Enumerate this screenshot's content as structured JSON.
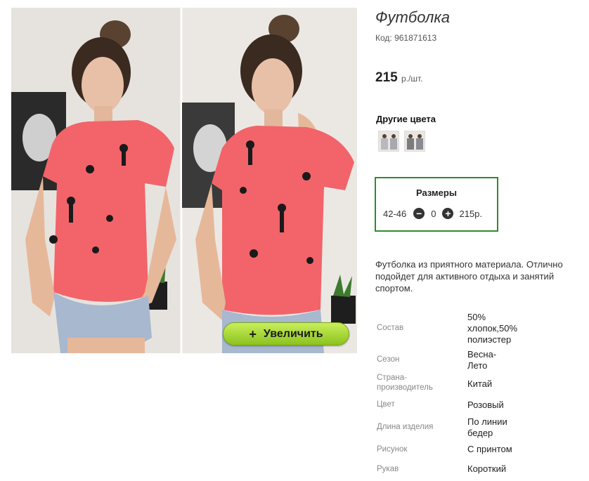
{
  "product": {
    "title": "Футболка",
    "sku": "Код: 961871613",
    "price": "215",
    "price_unit": "р./шт.",
    "zoom_label": "Увеличить",
    "zoom_plus": "+"
  },
  "other_colors": {
    "label": "Другие цвета",
    "swatches": [
      "color-swatch-1",
      "color-swatch-2"
    ]
  },
  "sizes": {
    "title": "Размеры",
    "rows": [
      {
        "size": "42-46",
        "minus": "−",
        "qty": "0",
        "plus": "+",
        "price": "215р."
      }
    ]
  },
  "description": "Футболка из приятного материала. Отлично подойдет для активного отдыха и занятий спортом.",
  "specs": [
    {
      "key": "Состав",
      "value": "50% хлопок,50% полиэстер"
    },
    {
      "key": "Сезон",
      "value": "Весна-Лето"
    },
    {
      "key": "Страна-производитель",
      "value": "Китай"
    },
    {
      "key": "Цвет",
      "value": "Розовый"
    },
    {
      "key": "Длина изделия",
      "value": "По линии бедер"
    },
    {
      "key": "Рисунок",
      "value": "С принтом"
    },
    {
      "key": "Рукав",
      "value": "Короткий"
    }
  ],
  "colors": {
    "shirt": "#f2646a",
    "accent_border": "#2e8b2e",
    "zoom_button": "#a6d43a"
  }
}
